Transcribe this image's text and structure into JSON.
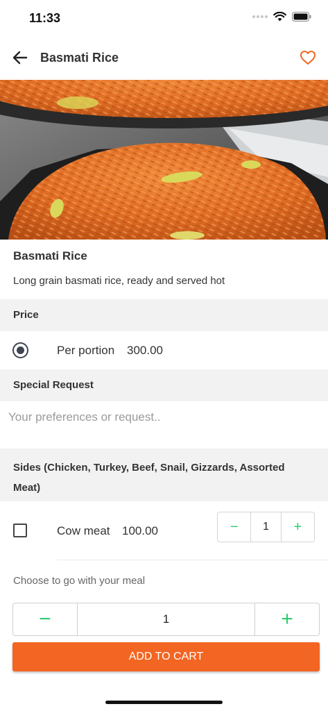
{
  "status_bar": {
    "time": "11:33",
    "icons": [
      "signal-dots-icon",
      "wifi-icon",
      "battery-icon"
    ]
  },
  "header": {
    "title": "Basmati Rice",
    "back_icon": "arrow-left-icon",
    "favorite_icon": "heart-outline-icon"
  },
  "item": {
    "title": "Basmati Rice",
    "description": "Long grain basmati rice, ready and served hot"
  },
  "price_section": {
    "header": "Price",
    "option": {
      "label": "Per portion",
      "value": "300.00",
      "selected": true
    }
  },
  "special_request": {
    "header": "Special Request",
    "placeholder": "Your preferences or request..",
    "value": ""
  },
  "sides": {
    "header": "Sides (Chicken, Turkey, Beef, Snail, Gizzards, Assorted Meat)",
    "items": [
      {
        "name": "Cow meat",
        "price": "100.00",
        "checked": false,
        "quantity": "1",
        "minus": "−",
        "plus": "+"
      }
    ]
  },
  "meal": {
    "choose_text": "Choose to go with your meal",
    "quantity": "1",
    "minus": "−",
    "plus": "+"
  },
  "cart": {
    "add_label": "ADD TO CART"
  },
  "colors": {
    "accent": "#f26522",
    "stepper_green": "#2ecc71",
    "section_bg": "#f2f2f2"
  }
}
